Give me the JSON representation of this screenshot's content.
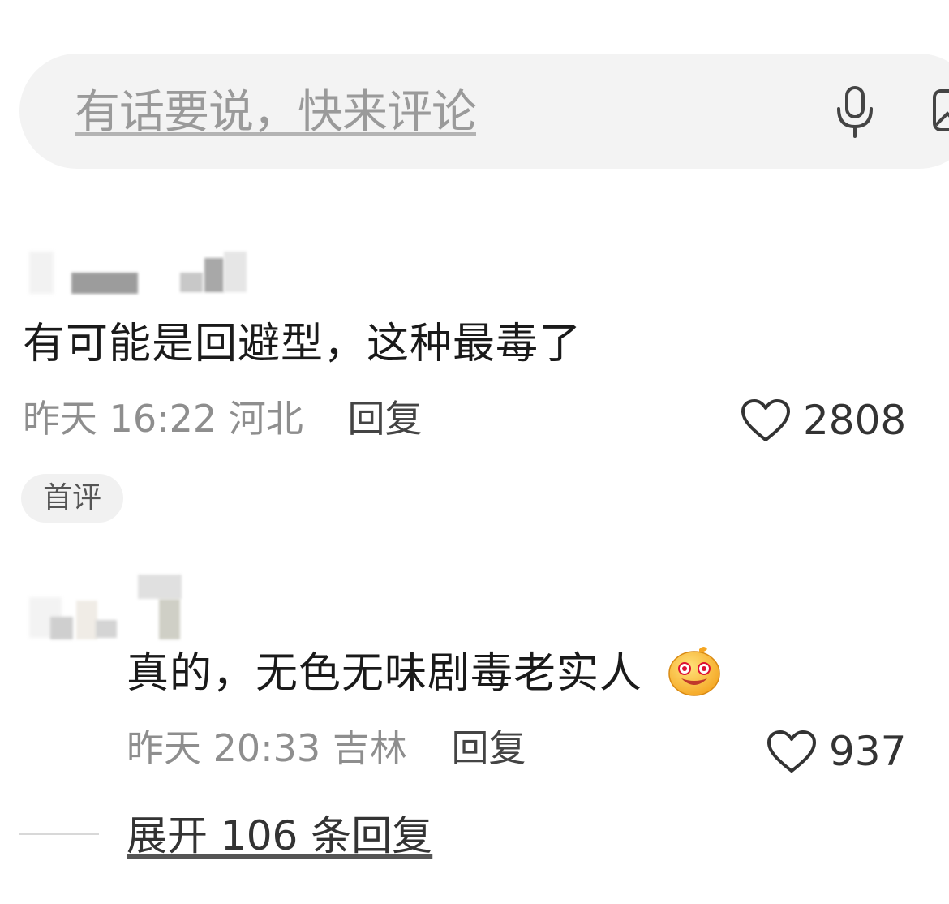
{
  "input": {
    "placeholder": "有话要说，快来评论"
  },
  "icons": {
    "mic": "microphone-icon",
    "image": "image-icon",
    "like": "heart-icon",
    "emoji": "grin-emoji-icon"
  },
  "comments": [
    {
      "text": "有可能是回避型，这种最毒了",
      "time": "昨天 16:22",
      "location": "河北",
      "reply_label": "回复",
      "likes": "2808",
      "badge": "首评"
    },
    {
      "text": "真的，无色无味剧毒老实人",
      "time": "昨天 20:33",
      "location": "吉林",
      "reply_label": "回复",
      "likes": "937"
    }
  ],
  "expand_label": "展开 106 条回复",
  "colors": {
    "input_bg": "#f3f3f3",
    "meta_text": "#8e8e8e",
    "badge_bg": "#f1f1f1"
  }
}
